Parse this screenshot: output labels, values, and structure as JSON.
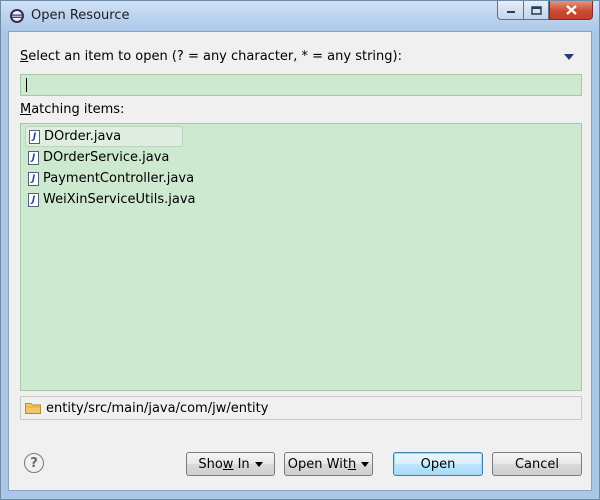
{
  "window": {
    "title": "Open Resource"
  },
  "prompt": {
    "prefix_underlined": "S",
    "rest": "elect an item to open (? = any character, * = any string):"
  },
  "search": {
    "value": "",
    "placeholder": ""
  },
  "matching": {
    "prefix_underlined": "M",
    "rest": "atching items:"
  },
  "results": [
    {
      "name": "DOrder.java",
      "icon": "java-file-icon",
      "selected": true
    },
    {
      "name": "DOrderService.java",
      "icon": "java-file-icon",
      "selected": false
    },
    {
      "name": "PaymentController.java",
      "icon": "java-file-icon",
      "selected": false
    },
    {
      "name": "WeiXinServiceUtils.java",
      "icon": "java-file-icon",
      "selected": false
    }
  ],
  "location": {
    "icon": "folder-icon",
    "path": "entity/src/main/java/com/jw/entity"
  },
  "buttons": {
    "show_in": {
      "prefix": "Sho",
      "underlined": "w",
      "suffix": " In"
    },
    "open_with": {
      "prefix": "Open Wit",
      "underlined": "h",
      "suffix": ""
    },
    "open": "Open",
    "cancel": "Cancel"
  },
  "colors": {
    "list_background": "#cde9d0",
    "title_bar": "#bcd4ef",
    "close_button": "#c94530"
  }
}
